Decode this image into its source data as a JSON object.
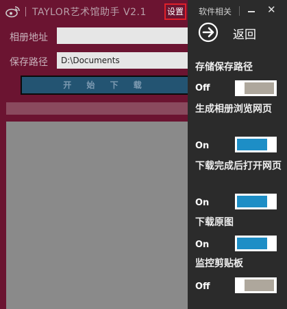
{
  "window": {
    "title": "TAYLOR艺术馆助手 V2.1",
    "settings_label": "设置",
    "logo_icon": "weibo-icon"
  },
  "form": {
    "album_label": "相册地址",
    "album_value": "",
    "path_label": "保存路径",
    "path_value": "D:\\Documents",
    "start_button": "开 始 下 载",
    "progress": 0
  },
  "panel": {
    "header_label": "软件相关",
    "minimize_icon": "minimize-icon",
    "close_icon": "close-icon",
    "back_icon": "arrow-right-circle-icon",
    "back_label": "返回",
    "options": [
      {
        "label": "存储保存路径",
        "state": "Off",
        "on": false
      },
      {
        "label": "生成相册浏览网页",
        "state": "On",
        "on": true
      },
      {
        "label": "下载完成后打开网页",
        "state": "On",
        "on": true
      },
      {
        "label": "下载原图",
        "state": "On",
        "on": true
      },
      {
        "label": "监控剪贴板",
        "state": "Off",
        "on": false
      }
    ]
  },
  "colors": {
    "main_bg": "#6b1431",
    "panel_bg": "#2b2b2b",
    "toggle_on": "#1d8ec6",
    "toggle_off": "#aea79c",
    "highlight": "#e0202a"
  }
}
